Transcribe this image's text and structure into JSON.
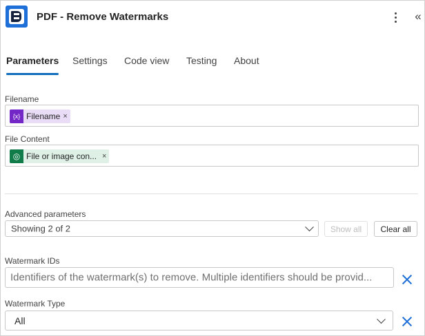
{
  "header": {
    "title": "PDF - Remove Watermarks",
    "app_icon": "encodian-logo-icon",
    "more_icon": "more-vertical-icon",
    "collapse_icon": "double-chevron-left-icon",
    "collapse_glyph": "«"
  },
  "tabs": [
    {
      "label": "Parameters",
      "active": true
    },
    {
      "label": "Settings",
      "active": false
    },
    {
      "label": "Code view",
      "active": false
    },
    {
      "label": "Testing",
      "active": false
    },
    {
      "label": "About",
      "active": false
    }
  ],
  "fields": {
    "filename": {
      "label": "Filename",
      "token": {
        "text": "Filename",
        "icon": "variable-icon",
        "icon_glyph": "{x}",
        "color": "#7427c7",
        "bg": "#e9dcf6",
        "close": "×"
      }
    },
    "file_content": {
      "label": "File Content",
      "token": {
        "text": "File or image con...",
        "icon": "dataverse-icon",
        "icon_glyph": "◎",
        "color": "#0f7c4a",
        "bg": "#dff0e6",
        "close": "×"
      }
    }
  },
  "advanced": {
    "label": "Advanced parameters",
    "selected": "Showing 2 of 2",
    "show_all": "Show all",
    "clear_all": "Clear all"
  },
  "watermark_ids": {
    "label": "Watermark IDs",
    "placeholder": "Identifiers of the watermark(s) to remove. Multiple identifiers should be provid..."
  },
  "watermark_type": {
    "label": "Watermark Type",
    "selected": "All"
  },
  "colors": {
    "accent": "#0f6cbd",
    "remove_icon": "#1f6fd8"
  }
}
